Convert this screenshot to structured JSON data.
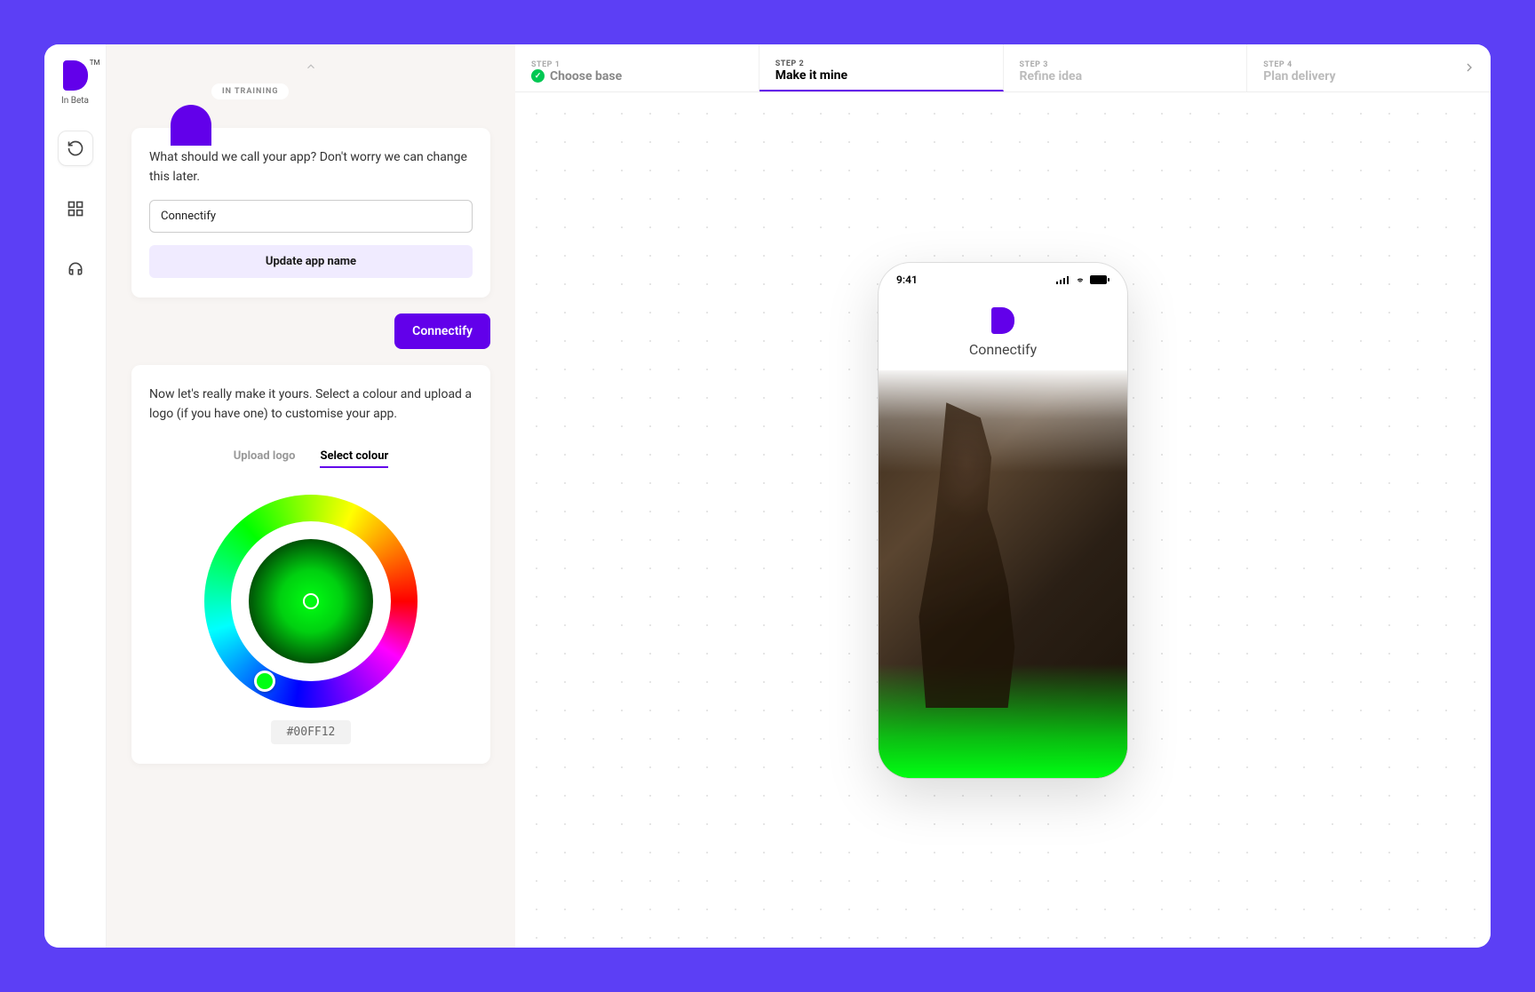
{
  "sidebar": {
    "logo_caption": "In Beta",
    "logo_tm": "TM"
  },
  "chat": {
    "training_badge": "IN TRAINING",
    "prompt1": "What should we call your app? Don't worry we can change this later.",
    "app_name_value": "Connectify",
    "update_btn": "Update app name",
    "user_reply": "Connectify",
    "prompt2": "Now let's really make it yours. Select a colour and upload a logo (if you have one) to customise your app.",
    "tab_upload": "Upload logo",
    "tab_colour": "Select colour",
    "hex_value": "#00FF12"
  },
  "stepper": {
    "steps": [
      {
        "num": "STEP 1",
        "title": "Choose base"
      },
      {
        "num": "STEP 2",
        "title": "Make it mine"
      },
      {
        "num": "STEP 3",
        "title": "Refine idea"
      },
      {
        "num": "STEP 4",
        "title": "Plan delivery"
      }
    ]
  },
  "phone": {
    "time": "9:41",
    "app_name": "Connectify"
  }
}
